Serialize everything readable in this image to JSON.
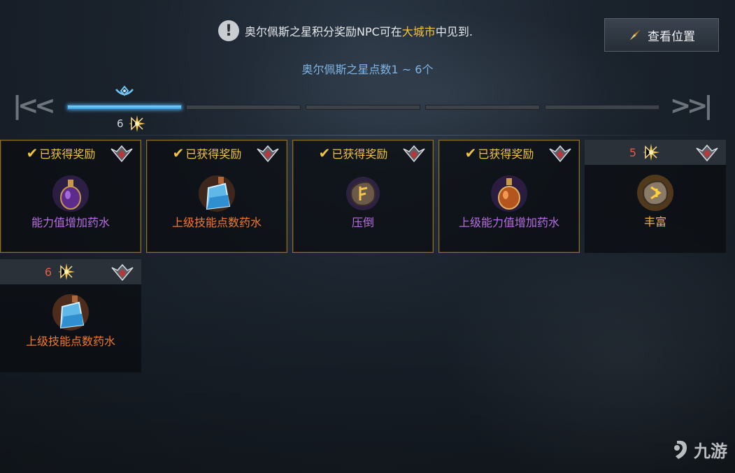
{
  "notice": {
    "icon": "exclamation-icon",
    "text_before": "奥尔佩斯之星积分奖励NPC可在",
    "highlight": "大城市",
    "text_after": "中见到.",
    "highlight_color": "#f4c531"
  },
  "locate_button": {
    "label": "查看位置",
    "icon": "compass-needle-icon"
  },
  "range_text": "奥尔佩斯之星点数1 ~ 6个",
  "progress": {
    "segments": 5,
    "active_segment": 1,
    "current_count": "6",
    "accent": "#4fb4ec"
  },
  "nav": {
    "first": "first-page-icon",
    "last": "last-page-icon"
  },
  "rewards": [
    {
      "status": "已获得奖励",
      "cost": "",
      "name": "能力值增加药水",
      "icon": "purple-potion-icon",
      "name_color": "purple"
    },
    {
      "status": "已获得奖励",
      "cost": "",
      "name": "上级技能点数药水",
      "icon": "blue-flask-icon",
      "name_color": "orange"
    },
    {
      "status": "已获得奖励",
      "cost": "",
      "name": "压倒",
      "icon": "rune-stone-icon",
      "name_color": "purple"
    },
    {
      "status": "已获得奖励",
      "cost": "",
      "name": "上级能力值增加药水",
      "icon": "orange-potion-icon",
      "name_color": "purple"
    },
    {
      "status": "",
      "cost": "5",
      "name": "丰富",
      "icon": "gold-rune-stone-icon",
      "name_color": "gold"
    },
    {
      "status": "",
      "cost": "6",
      "name": "上级技能点数药水",
      "icon": "blue-flask-icon",
      "name_color": "orange"
    }
  ],
  "watermark": {
    "text": "九游",
    "icon": "nine-game-logo-icon"
  }
}
